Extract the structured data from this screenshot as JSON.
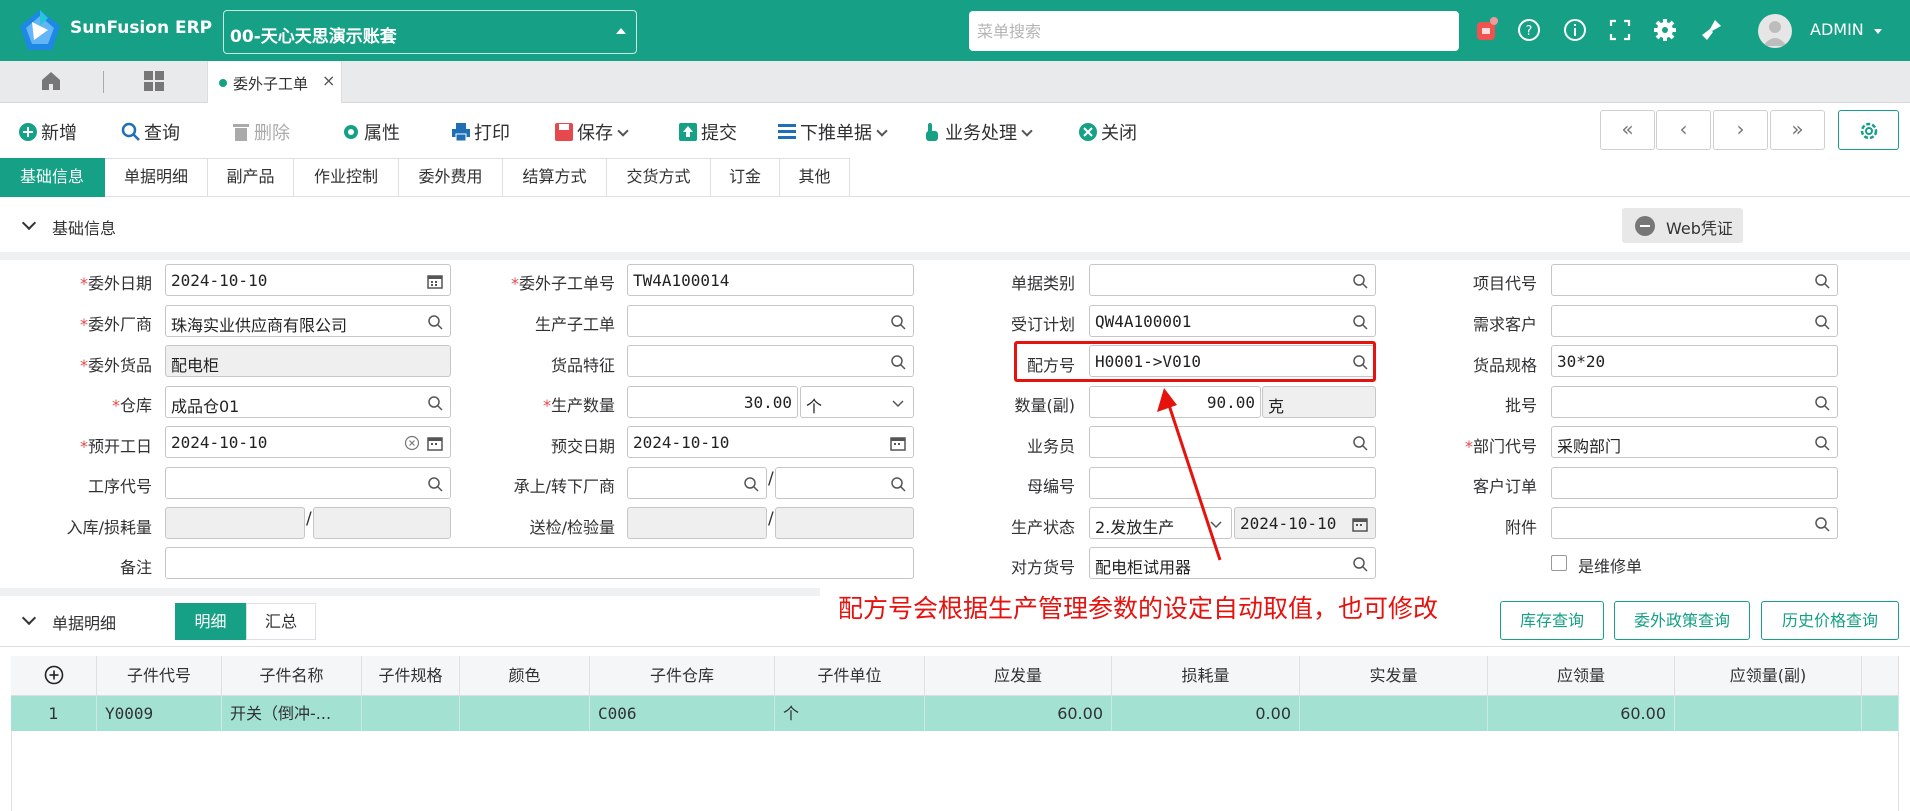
{
  "app": {
    "brand": "SunFusion ERP",
    "account": "00-天心天思演示账套",
    "search_placeholder": "菜单搜索",
    "user": "ADMIN",
    "colors": {
      "primary": "#16a085",
      "annotation": "#e5120e"
    }
  },
  "tabs": {
    "open_tab": "委外子工单"
  },
  "toolbar": {
    "new": "新增",
    "query": "查询",
    "delete": "删除",
    "props": "属性",
    "print": "打印",
    "save": "保存",
    "submit": "提交",
    "push_down": "下推单据",
    "business": "业务处理",
    "close": "关闭",
    "nav": [
      "«",
      "‹",
      "›",
      "»"
    ]
  },
  "form_tabs": [
    "基础信息",
    "单据明细",
    "副产品",
    "作业控制",
    "委外费用",
    "结算方式",
    "交货方式",
    "订金",
    "其他"
  ],
  "basic": {
    "section_title": "基础信息",
    "web_voucher": "Web凭证",
    "labels": {
      "outsource_date": "委外日期",
      "outsource_no": "委外子工单号",
      "doc_type": "单据类别",
      "project_code": "项目代号",
      "vendor": "委外厂商",
      "prod_sub_order": "生产子工单",
      "order_plan": "受订计划",
      "demand_customer": "需求客户",
      "goods": "委外货品",
      "goods_feature": "货品特征",
      "formula": "配方号",
      "goods_spec": "货品规格",
      "warehouse": "仓库",
      "prod_qty": "生产数量",
      "qty_aux": "数量(副)",
      "batch": "批号",
      "plan_start": "预开工日",
      "plan_delivery": "预交日期",
      "salesman": "业务员",
      "dept": "部门代号",
      "process_code": "工序代号",
      "transfer_vendor": "承上/转下厂商",
      "parent_no": "母编号",
      "customer_order": "客户订单",
      "inbound_loss": "入库/损耗量",
      "inspect_qty": "送检/检验量",
      "prod_status": "生产状态",
      "attachment": "附件",
      "remark": "备注",
      "counter_goods": "对方货号",
      "is_repair": "是维修单"
    },
    "values": {
      "outsource_date": "2024-10-10",
      "outsource_no": "TW4A100014",
      "vendor": "珠海实业供应商有限公司",
      "order_plan": "QW4A100001",
      "goods": "配电柜",
      "formula": "H0001->V010",
      "goods_spec": "30*20",
      "warehouse": "成品仓01",
      "prod_qty": "30.00",
      "prod_unit": "个",
      "qty_aux": "90.00",
      "aux_unit": "克",
      "plan_start": "2024-10-10",
      "plan_delivery": "2024-10-10",
      "dept": "采购部门",
      "prod_status": "2.发放生产",
      "status_date": "2024-10-10",
      "counter_goods": "配电柜试用器"
    }
  },
  "annotation": "配方号会根据生产管理参数的设定自动取值，也可修改",
  "detail": {
    "section_title": "单据明细",
    "seg": [
      "明细",
      "汇总"
    ],
    "buttons": [
      "库存查询",
      "委外政策查询",
      "历史价格查询"
    ],
    "columns": [
      "子件代号",
      "子件名称",
      "子件规格",
      "颜色",
      "子件仓库",
      "子件单位",
      "应发量",
      "损耗量",
      "实发量",
      "应领量",
      "应领量(副)"
    ],
    "rows": [
      {
        "no": "1",
        "code": "Y0009",
        "name": "开关（倒冲-...",
        "spec": "",
        "color": "",
        "wh": "C006",
        "unit": "个",
        "issue": "60.00",
        "loss": "0.00",
        "actual": "",
        "req": "60.00",
        "req_aux": ""
      }
    ]
  }
}
